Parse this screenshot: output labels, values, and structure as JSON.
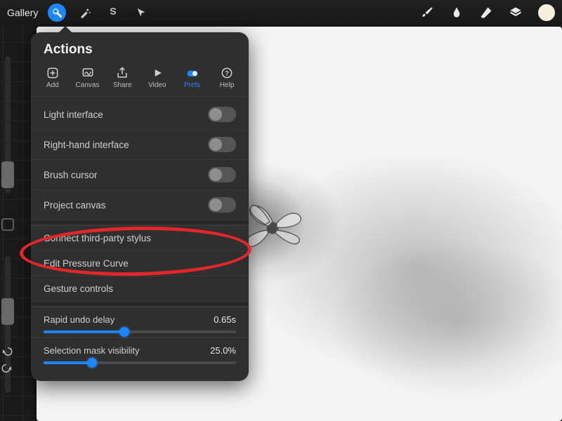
{
  "topbar": {
    "gallery": "Gallery"
  },
  "popover": {
    "title": "Actions",
    "tabs": {
      "add": "Add",
      "canvas": "Canvas",
      "share": "Share",
      "video": "Video",
      "prefs": "Prefs",
      "help": "Help"
    },
    "toggles": {
      "light_interface": "Light interface",
      "right_hand": "Right-hand interface",
      "brush_cursor": "Brush cursor",
      "project_canvas": "Project canvas"
    },
    "links": {
      "connect_stylus": "Connect third-party stylus",
      "edit_pressure": "Edit Pressure Curve",
      "gesture_controls": "Gesture controls"
    },
    "sliders": {
      "rapid_undo": {
        "label": "Rapid undo delay",
        "value": "0.65s",
        "pct": 42
      },
      "selection_mask": {
        "label": "Selection mask visibility",
        "value": "25.0%",
        "pct": 25
      }
    }
  }
}
